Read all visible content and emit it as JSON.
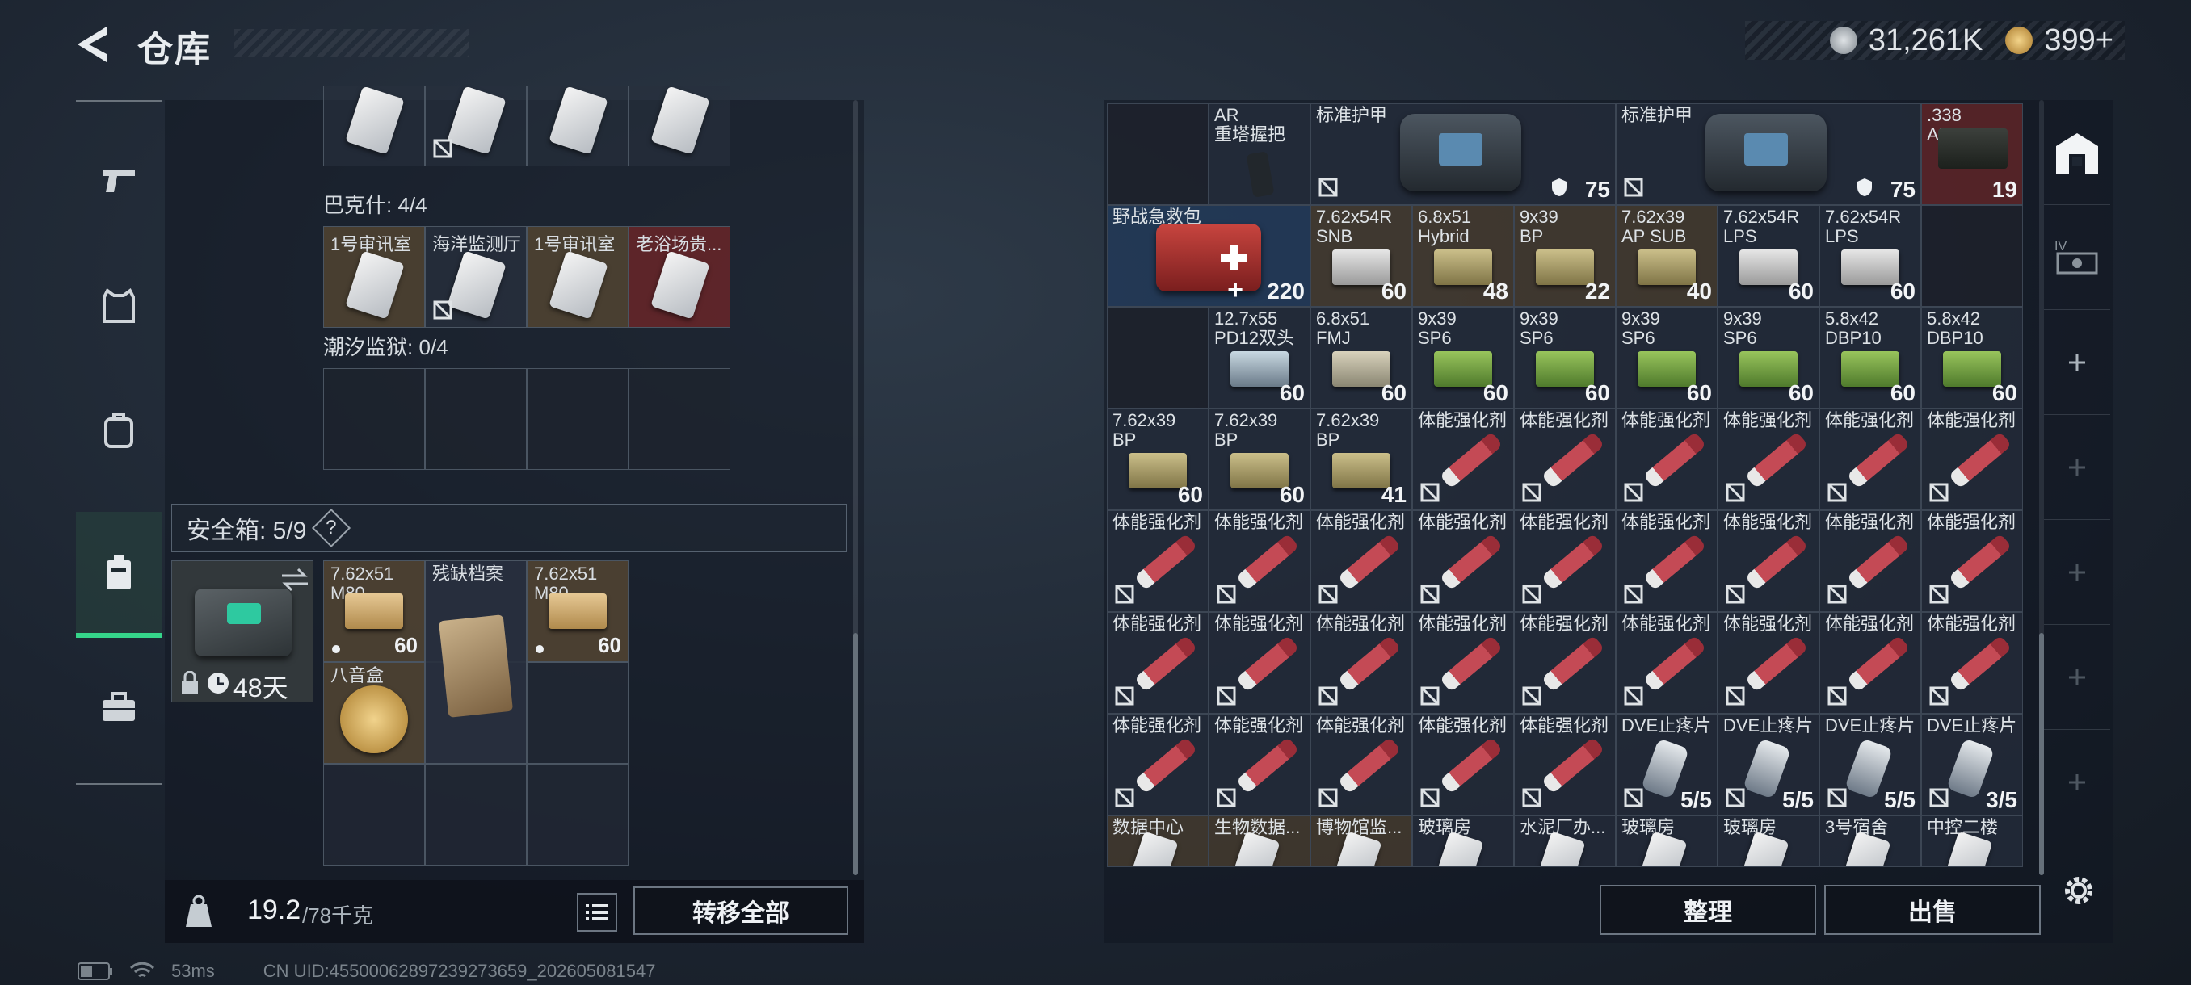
{
  "header": {
    "title": "仓库",
    "currency_1": "31,261K",
    "currency_2": "399+"
  },
  "left": {
    "barker_label": "巴克什: 4/4",
    "barker_items": [
      "1号审讯室",
      "海洋监测厅",
      "1号审讯室",
      "老浴场贵..."
    ],
    "tide_label": "潮汐监狱: 0/4",
    "safe_label": "安全箱: 5/9",
    "safe_help": "?",
    "safe_timer": "48天",
    "safe_items": [
      {
        "label": "7.62x51 M80",
        "count": "60"
      },
      {
        "label": "残缺档案",
        "count": ""
      },
      {
        "label": "7.62x51 M80",
        "count": "60"
      },
      {
        "label": "八音盒",
        "count": ""
      }
    ],
    "weight": "19.2",
    "weight_max": "/78千克",
    "transfer_all": "转移全部"
  },
  "right": {
    "rows": [
      [
        {
          "t": "",
          "n": "",
          "c": "dark"
        },
        {
          "t": "AR\n重塔握把",
          "n": "",
          "c": ""
        },
        {
          "t": "标准护甲",
          "n": "75",
          "c": "",
          "w": 3
        },
        {
          "t": "标准护甲",
          "n": "75",
          "c": "",
          "w": 3
        },
        {
          "t": ".338\nAP",
          "n": "19",
          "c": "red"
        }
      ],
      [
        {
          "t": "野战急救包",
          "n": "220",
          "c": "blue",
          "w": 2
        },
        {
          "t": "7.62x54R\nSNB",
          "n": "60",
          "c": "tan"
        },
        {
          "t": "6.8x51\nHybrid",
          "n": "48",
          "c": "tan"
        },
        {
          "t": "9x39\nBP",
          "n": "22",
          "c": "tan"
        },
        {
          "t": "7.62x39\nAP SUB",
          "n": "40",
          "c": "tan"
        },
        {
          "t": "7.62x54R\nLPS",
          "n": "60",
          "c": ""
        },
        {
          "t": "7.62x54R\nLPS",
          "n": "60",
          "c": ""
        },
        {
          "t": "",
          "n": "",
          "c": "dark"
        }
      ],
      [
        {
          "t": "",
          "n": "",
          "c": "dark"
        },
        {
          "t": "12.7x55\nPD12双头",
          "n": "60",
          "c": ""
        },
        {
          "t": "6.8x51\nFMJ",
          "n": "60",
          "c": ""
        },
        {
          "t": "9x39\nSP6",
          "n": "60",
          "c": ""
        },
        {
          "t": "9x39\nSP6",
          "n": "60",
          "c": ""
        },
        {
          "t": "9x39\nSP6",
          "n": "60",
          "c": ""
        },
        {
          "t": "9x39\nSP6",
          "n": "60",
          "c": ""
        },
        {
          "t": "5.8x42\nDBP10",
          "n": "60",
          "c": ""
        },
        {
          "t": "5.8x42\nDBP10",
          "n": "60",
          "c": ""
        }
      ],
      [
        {
          "t": "7.62x39\nBP",
          "n": "60",
          "c": ""
        },
        {
          "t": "7.62x39\nBP",
          "n": "60",
          "c": ""
        },
        {
          "t": "7.62x39\nBP",
          "n": "41",
          "c": ""
        },
        {
          "t": "体能强化剂",
          "n": "",
          "c": ""
        },
        {
          "t": "体能强化剂",
          "n": "",
          "c": ""
        },
        {
          "t": "体能强化剂",
          "n": "",
          "c": ""
        },
        {
          "t": "体能强化剂",
          "n": "",
          "c": ""
        },
        {
          "t": "体能强化剂",
          "n": "",
          "c": ""
        },
        {
          "t": "体能强化剂",
          "n": "",
          "c": ""
        }
      ],
      [
        {
          "t": "体能强化剂",
          "n": "",
          "c": ""
        },
        {
          "t": "体能强化剂",
          "n": "",
          "c": ""
        },
        {
          "t": "体能强化剂",
          "n": "",
          "c": ""
        },
        {
          "t": "体能强化剂",
          "n": "",
          "c": ""
        },
        {
          "t": "体能强化剂",
          "n": "",
          "c": ""
        },
        {
          "t": "体能强化剂",
          "n": "",
          "c": ""
        },
        {
          "t": "体能强化剂",
          "n": "",
          "c": ""
        },
        {
          "t": "体能强化剂",
          "n": "",
          "c": ""
        },
        {
          "t": "体能强化剂",
          "n": "",
          "c": ""
        }
      ],
      [
        {
          "t": "体能强化剂",
          "n": "",
          "c": ""
        },
        {
          "t": "体能强化剂",
          "n": "",
          "c": ""
        },
        {
          "t": "体能强化剂",
          "n": "",
          "c": ""
        },
        {
          "t": "体能强化剂",
          "n": "",
          "c": ""
        },
        {
          "t": "体能强化剂",
          "n": "",
          "c": ""
        },
        {
          "t": "体能强化剂",
          "n": "",
          "c": ""
        },
        {
          "t": "体能强化剂",
          "n": "",
          "c": ""
        },
        {
          "t": "体能强化剂",
          "n": "",
          "c": ""
        },
        {
          "t": "体能强化剂",
          "n": "",
          "c": ""
        }
      ],
      [
        {
          "t": "体能强化剂",
          "n": "",
          "c": ""
        },
        {
          "t": "体能强化剂",
          "n": "",
          "c": ""
        },
        {
          "t": "体能强化剂",
          "n": "",
          "c": ""
        },
        {
          "t": "体能强化剂",
          "n": "",
          "c": ""
        },
        {
          "t": "体能强化剂",
          "n": "",
          "c": ""
        },
        {
          "t": "DVE止疼片",
          "n": "5/5",
          "c": ""
        },
        {
          "t": "DVE止疼片",
          "n": "5/5",
          "c": ""
        },
        {
          "t": "DVE止疼片",
          "n": "5/5",
          "c": ""
        },
        {
          "t": "DVE止疼片",
          "n": "3/5",
          "c": ""
        }
      ],
      [
        {
          "t": "数据中心",
          "n": "",
          "c": "tan"
        },
        {
          "t": "生物数据...",
          "n": "",
          "c": "tan"
        },
        {
          "t": "博物馆监...",
          "n": "",
          "c": "tan"
        },
        {
          "t": "玻璃房",
          "n": "",
          "c": ""
        },
        {
          "t": "水泥厂办...",
          "n": "",
          "c": ""
        },
        {
          "t": "玻璃房",
          "n": "",
          "c": ""
        },
        {
          "t": "玻璃房",
          "n": "",
          "c": ""
        },
        {
          "t": "3号宿舍",
          "n": "",
          "c": ""
        },
        {
          "t": "中控二楼",
          "n": "",
          "c": ""
        }
      ]
    ],
    "sort": "整理",
    "sell": "出售"
  },
  "status": {
    "ping": "53ms",
    "uid": "CN UID:4550006289723927365​9_202605081547"
  }
}
